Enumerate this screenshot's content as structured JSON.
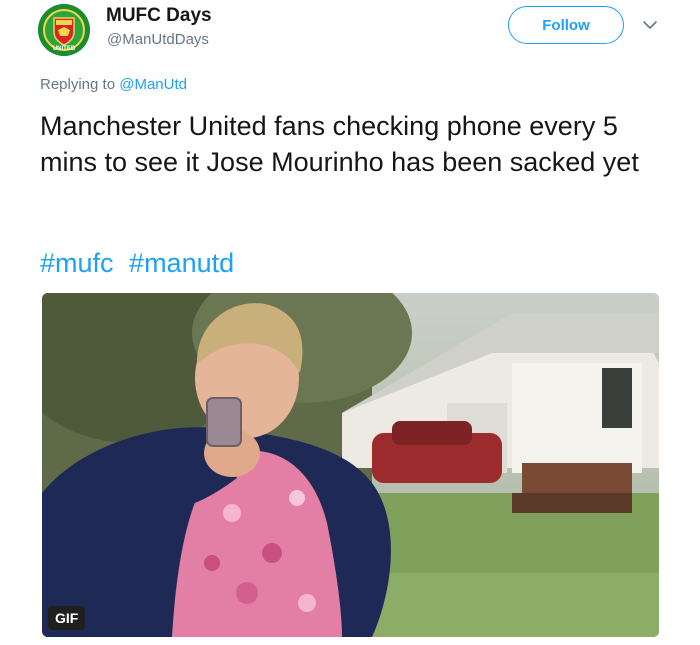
{
  "user": {
    "display_name": "MUFC Days",
    "handle": "@ManUtdDays",
    "avatar_icon": "manchester-united-crest-icon",
    "avatar_color": "#1d8c2e",
    "crest_text": "UNITED"
  },
  "follow_button": {
    "label": "Follow"
  },
  "more_menu_icon": "chevron-down-icon",
  "reply": {
    "prefix": "Replying to",
    "mention": "@ManUtd"
  },
  "tweet": {
    "text": "Manchester United fans checking phone every 5 mins to see it Jose Mourinho has been sacked yet",
    "hashtags": [
      "#mufc",
      "#manutd"
    ]
  },
  "media": {
    "type": "gif",
    "badge": "GIF",
    "description_icon": "woman-looking-at-phone-gif"
  },
  "colors": {
    "accent": "#1da1f2",
    "text": "#14171a",
    "secondary_text": "#657786"
  }
}
